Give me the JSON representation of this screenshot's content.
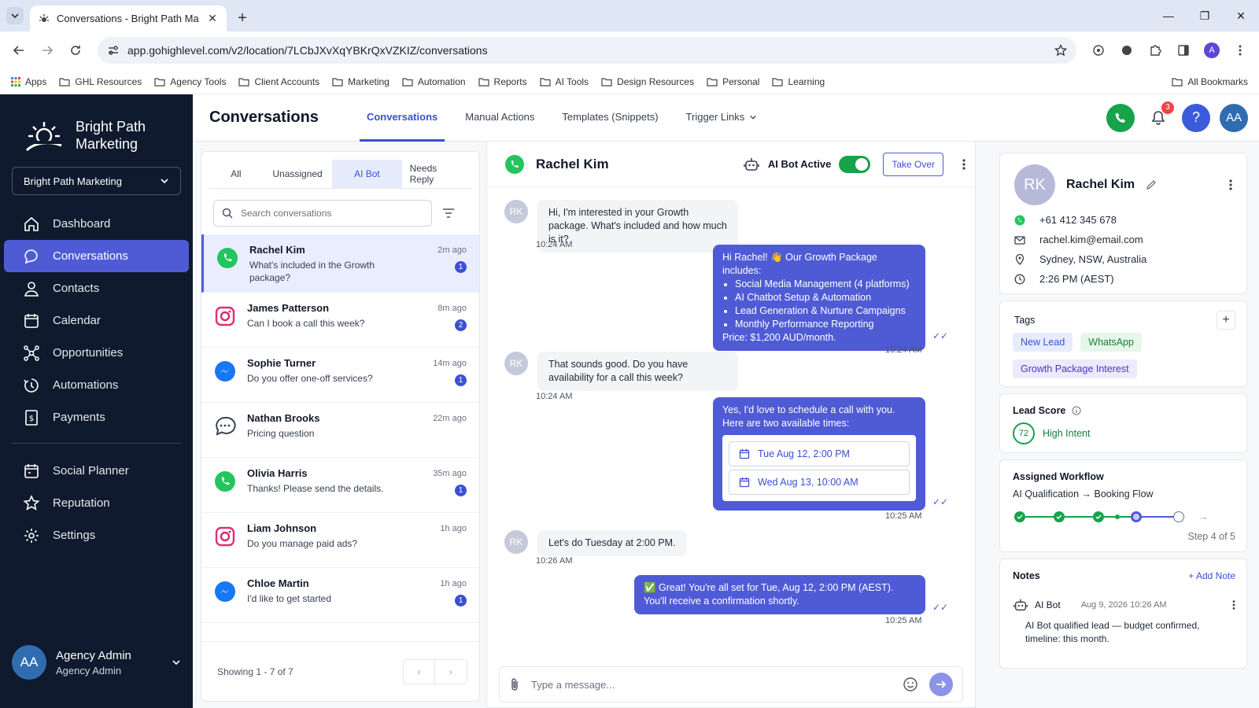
{
  "browser": {
    "tab_title": "Conversations - Bright Path Ma",
    "url": "app.gohighlevel.com/v2/location/7LCbJXvXqYBKrQxVZKIZ/conversations",
    "profile_initial": "A",
    "bookmarks": [
      "Apps",
      "GHL Resources",
      "Agency Tools",
      "Client Accounts",
      "Marketing",
      "Automation",
      "Reports",
      "AI Tools",
      "Design Resources",
      "Personal",
      "Learning"
    ],
    "all_bookmarks": "All Bookmarks"
  },
  "sidebar": {
    "brand": "Bright Path Marketing",
    "account_select": "Bright Path Marketing",
    "items": [
      {
        "label": "Dashboard",
        "icon": "home-icon"
      },
      {
        "label": "Conversations",
        "icon": "chat-icon",
        "active": true
      },
      {
        "label": "Contacts",
        "icon": "user-icon"
      },
      {
        "label": "Calendar",
        "icon": "calendar-icon"
      },
      {
        "label": "Opportunities",
        "icon": "opportunities-icon"
      },
      {
        "label": "Automations",
        "icon": "automation-icon"
      },
      {
        "label": "Payments",
        "icon": "payments-icon"
      }
    ],
    "items2": [
      {
        "label": "Social Planner",
        "icon": "social-planner-icon"
      },
      {
        "label": "Reputation",
        "icon": "star-icon"
      },
      {
        "label": "Settings",
        "icon": "gear-icon"
      }
    ],
    "profile": {
      "initials": "AA",
      "name": "Agency Admin",
      "role": "Agency Admin"
    }
  },
  "topnav": {
    "title": "Conversations",
    "tabs": [
      "Conversations",
      "Manual Actions",
      "Templates (Snippets)",
      "Trigger Links"
    ],
    "notifications": "3",
    "user_initials": "AA",
    "colors": {
      "phone": "#16a34a",
      "help": "#3b5bdb",
      "avatar": "#2f6db0"
    }
  },
  "list": {
    "filters": [
      "All",
      "Unassigned",
      "AI Bot",
      "Needs Reply"
    ],
    "search_placeholder": "Search conversations",
    "items": [
      {
        "name": "Rachel Kim",
        "preview": "What's included in the Growth package?",
        "time": "2m ago",
        "unread": "1",
        "channel": "whatsapp-icon"
      },
      {
        "name": "James Patterson",
        "preview": "Can I book a call this week?",
        "time": "8m ago",
        "unread": "2",
        "channel": "instagram-icon"
      },
      {
        "name": "Sophie Turner",
        "preview": "Do you offer one-off services?",
        "time": "14m ago",
        "unread": "1",
        "channel": "messenger-icon"
      },
      {
        "name": "Nathan Brooks",
        "preview": "Pricing question",
        "time": "22m ago",
        "unread": "",
        "channel": "sms-icon"
      },
      {
        "name": "Olivia Harris",
        "preview": "Thanks! Please send the details.",
        "time": "35m ago",
        "unread": "1",
        "channel": "whatsapp-icon"
      },
      {
        "name": "Liam Johnson",
        "preview": "Do you manage paid ads?",
        "time": "1h ago",
        "unread": "",
        "channel": "instagram-icon"
      },
      {
        "name": "Chloe Martin",
        "preview": "I'd like to get started",
        "time": "1h ago",
        "unread": "1",
        "channel": "messenger-icon"
      }
    ],
    "footer": "Showing 1 - 7 of 7"
  },
  "chat": {
    "contact": "Rachel Kim",
    "ai_bot_label": "AI Bot Active",
    "take_over": "Take Over",
    "avatar_initials": "RK",
    "msg1": "Hi, I'm interested in your Growth package. What's included and how much is it?",
    "msg1_time": "10:24 AM",
    "reply1_intro": "Hi Rachel! 👋 Our Growth Package includes:",
    "reply1_items": [
      "Social Media Management (4 platforms)",
      "AI Chatbot Setup & Automation",
      "Lead Generation & Nurture Campaigns",
      "Monthly Performance Reporting"
    ],
    "reply1_price": "Price: $1,200 AUD/month.",
    "reply1_time": "10:24 AM",
    "msg2": "That sounds good. Do you have availability for a call this week?",
    "msg2_time": "10:24 AM",
    "reply2_text": "Yes, I'd love to schedule a call with you. Here are two available times:",
    "slot1": "Tue Aug 12, 2:00 PM",
    "slot2": "Wed Aug 13, 10:00 AM",
    "reply2_time": "10:25 AM",
    "msg3": "Let's do Tuesday at 2:00 PM.",
    "msg3_time": "10:26 AM",
    "reply3": "✅ Great! You're all set for Tue, Aug 12, 2:00 PM (AEST). You'll receive a confirmation shortly.",
    "reply3_time": "10:25 AM",
    "composer_placeholder": "Type a message..."
  },
  "contact": {
    "initials": "RK",
    "name": "Rachel Kim",
    "phone": "+61 412 345 678",
    "email": "rachel.kim@email.com",
    "location": "Sydney, NSW, Australia",
    "local_time": "2:26 PM (AEST)",
    "tags_title": "Tags",
    "tags": [
      "New Lead",
      "WhatsApp",
      "Growth Package Interest"
    ],
    "lead_score_title": "Lead Score",
    "lead_score": "72",
    "lead_intent": "High Intent",
    "workflow_title": "Assigned Workflow",
    "workflow_name": "AI Qualification → Booking Flow",
    "workflow_step": "Step 4 of 5",
    "workflow_progress": 0.8,
    "notes_title": "Notes",
    "add_note": "+ Add Note",
    "note_author": "AI Bot",
    "note_date": "Aug 9, 2026 10:26 AM",
    "note_text": "AI Bot qualified lead — budget confirmed, timeline: this month."
  }
}
